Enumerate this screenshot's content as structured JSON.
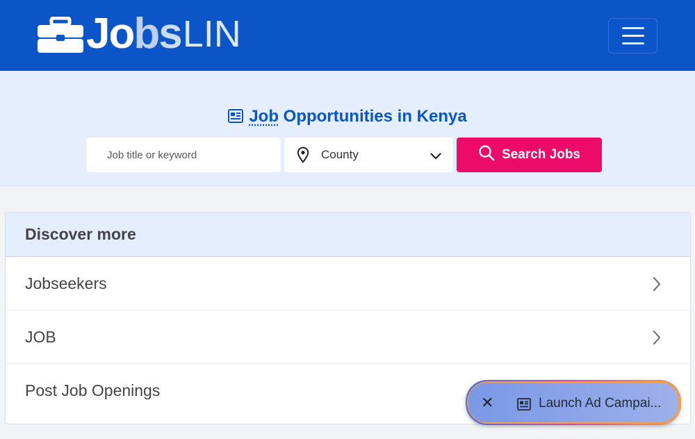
{
  "brand": {
    "logo_main": "Jobs",
    "logo_suffix": "LIN"
  },
  "hero": {
    "title_prefix": "Job",
    "title_rest": "Opportunities in Kenya",
    "search_placeholder": "Job title or keyword",
    "county_label": "County",
    "search_button": "Search Jobs"
  },
  "discover": {
    "heading": "Discover more",
    "items": [
      {
        "label": "Jobseekers"
      },
      {
        "label": "JOB"
      },
      {
        "label": "Post Job Openings"
      }
    ]
  },
  "ad": {
    "label": "Launch Ad Campai..."
  },
  "icons": {
    "menu": "hamburger-icon",
    "title": "newspaper-icon",
    "county": "map-pin-icon",
    "dropdown": "chevron-down-icon",
    "search": "search-icon",
    "row_arrow": "chevron-right-icon",
    "close": "close-icon",
    "ad": "newspaper-icon"
  },
  "colors": {
    "header_bg": "#0b55c8",
    "hero_bg": "#e4eefe",
    "accent": "#ec0a6a",
    "title_color": "#0b55c8"
  }
}
